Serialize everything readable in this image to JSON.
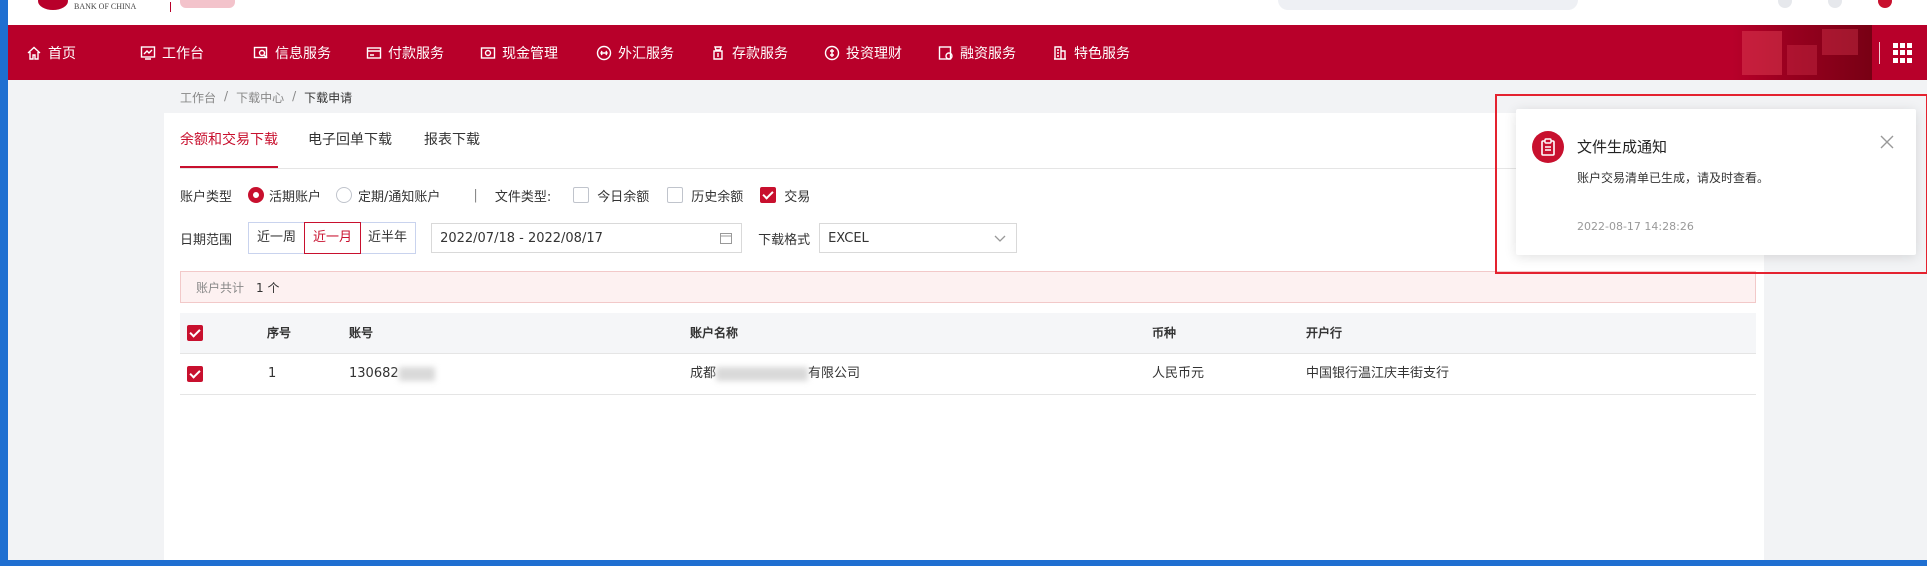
{
  "header": {
    "logo_text": "BANK OF CHINA"
  },
  "nav": {
    "items": [
      {
        "label": "首页",
        "icon": "home-icon"
      },
      {
        "label": "工作台",
        "icon": "dashboard-icon"
      },
      {
        "label": "信息服务",
        "icon": "info-search-icon"
      },
      {
        "label": "付款服务",
        "icon": "payment-icon"
      },
      {
        "label": "现金管理",
        "icon": "cash-icon"
      },
      {
        "label": "外汇服务",
        "icon": "forex-icon"
      },
      {
        "label": "存款服务",
        "icon": "deposit-icon"
      },
      {
        "label": "投资理财",
        "icon": "investment-icon"
      },
      {
        "label": "融资服务",
        "icon": "financing-icon"
      },
      {
        "label": "特色服务",
        "icon": "building-icon"
      }
    ]
  },
  "breadcrumb": [
    "工作台",
    "下载中心",
    "下载申请"
  ],
  "breadcrumb_sep": "/",
  "tabs": [
    "余额和交易下载",
    "电子回单下载",
    "报表下载"
  ],
  "filters": {
    "account_type_label": "账户类型",
    "account_types": [
      "活期账户",
      "定期/通知账户"
    ],
    "separator": "|",
    "file_type_label": "文件类型:",
    "file_types": [
      "今日余额",
      "历史余额",
      "交易"
    ],
    "date_range_label": "日期范围",
    "date_presets": [
      "近一周",
      "近一月",
      "近半年"
    ],
    "date_value": "2022/07/18 - 2022/08/17",
    "format_label": "下载格式",
    "format_value": "EXCEL"
  },
  "summary": {
    "label": "账户共计",
    "value": "1 个"
  },
  "table": {
    "headers": [
      "序号",
      "账号",
      "账户名称",
      "币种",
      "开户行"
    ],
    "rows": [
      {
        "index": "1",
        "account_prefix": "130682",
        "name_prefix": "成都",
        "name_suffix": "有限公司",
        "currency": "人民币元",
        "bank": "中国银行温江庆丰街支行"
      }
    ]
  },
  "notification": {
    "title": "文件生成通知",
    "message": "账户交易清单已生成，请及时查看。",
    "time": "2022-08-17 14:28:26"
  },
  "colors": {
    "brand": "#b8002a",
    "accent": "#c8102e"
  }
}
